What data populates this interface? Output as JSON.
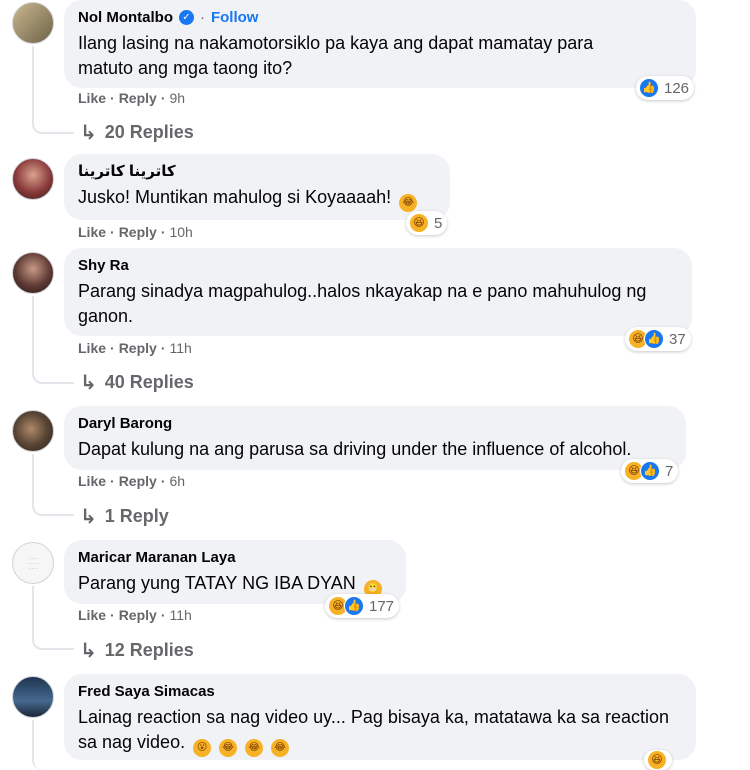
{
  "comments": [
    {
      "author": "Nol Montalbo",
      "verified": true,
      "follow_label": "Follow",
      "text": "Ilang lasing na nakamotorsiklo pa kaya ang dapat mamatay para matuto ang mga taong ito?",
      "like": "Like",
      "reply": "Reply",
      "time": "9h",
      "reaction_count": "126",
      "replies": "20 Replies",
      "avatar_color": "#9b8f6e"
    },
    {
      "author": "كاترينا كاترينا",
      "text": "Jusko! Muntikan mahulog si Koyaaaah!",
      "like": "Like",
      "reply": "Reply",
      "time": "10h",
      "reaction_count": "5",
      "avatar_color": "#6b2d2d"
    },
    {
      "author": "Shy Ra",
      "text": "Parang sinadya magpahulog..halos nkayakap na e pano mahuhulog ng ganon.",
      "like": "Like",
      "reply": "Reply",
      "time": "11h",
      "reaction_count": "37",
      "replies": "40 Replies",
      "avatar_color": "#3b2f2f"
    },
    {
      "author": "Daryl Barong",
      "text": "Dapat kulung na ang parusa sa driving under the influence of alcohol.",
      "like": "Like",
      "reply": "Reply",
      "time": "6h",
      "reaction_count": "7",
      "replies": "1 Reply",
      "avatar_color": "#5a4636"
    },
    {
      "author": "Maricar Maranan Laya",
      "text": "Parang yung TATAY NG IBA DYAN",
      "like": "Like",
      "reply": "Reply",
      "time": "11h",
      "reaction_count": "177",
      "replies": "12 Replies",
      "avatar_color": "#f4f4f4"
    },
    {
      "author": "Fred Saya Simacas",
      "text": "Lainag reaction sa nag video uy... Pag bisaya ka, matatawa ka sa reaction sa nag video.",
      "avatar_color": "#2d4a6b"
    }
  ],
  "colors": {
    "bubble": "#f0f2f5",
    "accent": "#1877f2",
    "meta": "#65676b"
  },
  "icons": {
    "like": "thumbs-up-icon",
    "haha": "laughing-face-icon",
    "reply_arrow": "reply-arrow-icon",
    "verified": "verified-badge-icon"
  }
}
